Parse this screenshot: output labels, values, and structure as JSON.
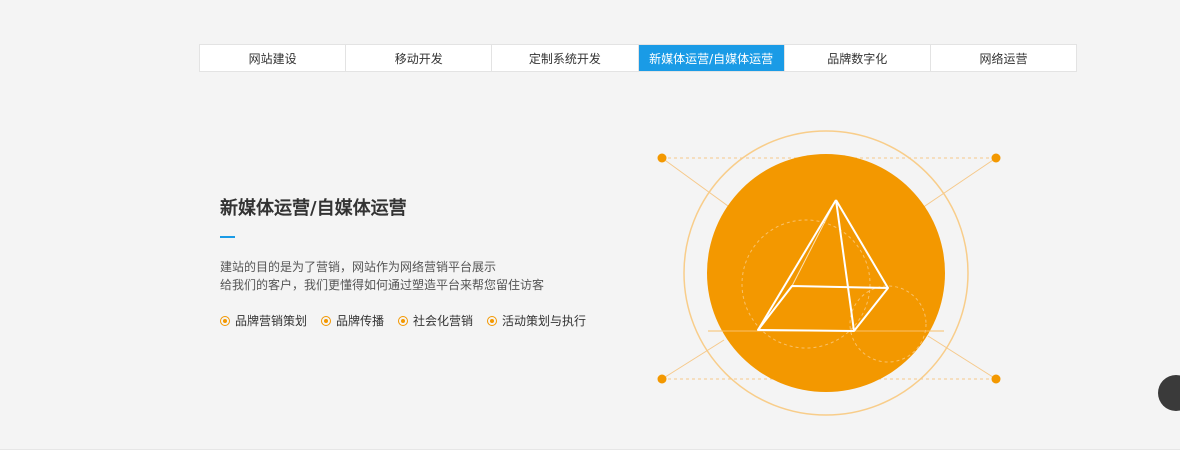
{
  "tabs": [
    {
      "label": "网站建设",
      "active": false
    },
    {
      "label": "移动开发",
      "active": false
    },
    {
      "label": "定制系统开发",
      "active": false
    },
    {
      "label": "新媒体运营/自媒体运营",
      "active": true
    },
    {
      "label": "品牌数字化",
      "active": false
    },
    {
      "label": "网络运营",
      "active": false
    }
  ],
  "section": {
    "title": "新媒体运营/自媒体运营",
    "description_lines": [
      "建站的目的是为了营销，网站作为网络营销平台展示",
      "给我们的客户，我们更懂得如何通过塑造平台来帮您留住访客"
    ],
    "features": [
      "品牌营销策划",
      "品牌传播",
      "社会化营销",
      "活动策划与执行"
    ]
  },
  "colors": {
    "accent_blue": "#1a9be6",
    "orange": "#f39800",
    "background": "#f4f4f4"
  },
  "icons": {
    "feature_bullet": "radio-dot-icon",
    "illustration": "pyramid-icon"
  }
}
